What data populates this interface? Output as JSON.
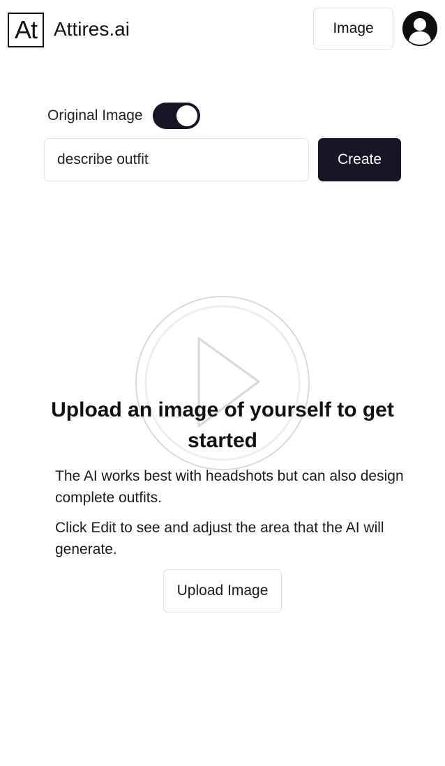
{
  "header": {
    "logo_text": "At",
    "brand_name": "Attires.ai",
    "image_button_label": "Image",
    "avatar_icon": "user-avatar-icon"
  },
  "controls": {
    "toggle_label": "Original Image",
    "toggle_on": true,
    "input_value": "describe outfit",
    "create_button_label": "Create"
  },
  "main": {
    "headline": "Upload an image of yourself to get started",
    "paragraph_1": "The AI works best with headshots but can also design complete outfits.",
    "paragraph_2": "Click Edit to see and adjust the area that the AI will generate.",
    "upload_button_label": "Upload Image",
    "overlay_icon": "play-icon"
  },
  "colors": {
    "primary_dark": "#161627",
    "background": "#ffffff",
    "border": "#e3e3e3",
    "text": "#111111"
  }
}
